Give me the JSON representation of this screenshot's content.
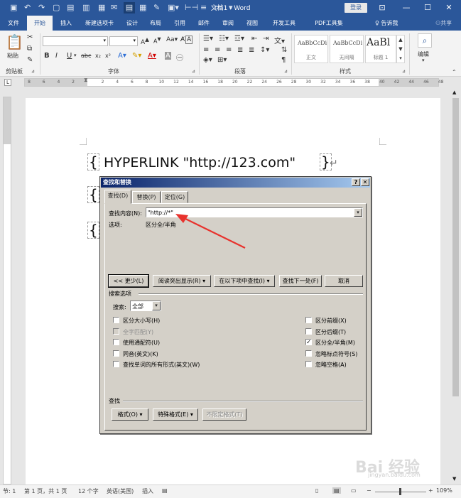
{
  "titlebar": {
    "title": "文档1 - Word",
    "login": "登录"
  },
  "menu": {
    "tabs": [
      "文件",
      "开始",
      "插入",
      "新建选项卡",
      "设计",
      "布局",
      "引用",
      "邮件",
      "审阅",
      "视图",
      "开发工具",
      "PDF工具集"
    ],
    "active_index": 1,
    "tell_me": "告诉我",
    "share": "共享"
  },
  "ribbon": {
    "clipboard_label": "剪贴板",
    "paste": "粘贴",
    "font_label": "字体",
    "paragraph_label": "段落",
    "styles_label": "样式",
    "edit": "编辑",
    "styles": [
      {
        "sample": "AaBbCcDi",
        "name": "正文"
      },
      {
        "sample": "AaBbCcDi",
        "name": "无间隔"
      },
      {
        "sample": "AaBl",
        "name": "标题 1"
      }
    ]
  },
  "ruler": {
    "labels": [
      "8",
      "6",
      "4",
      "2",
      "",
      "2",
      "4",
      "6",
      "8",
      "10",
      "12",
      "14",
      "16",
      "18",
      "20",
      "22",
      "24",
      "26",
      "28",
      "30",
      "32",
      "34",
      "36",
      "38",
      "40",
      "42",
      "44",
      "46",
      "48"
    ]
  },
  "document": {
    "field_code": " HYPERLINK \"http://123.com\" "
  },
  "dialog": {
    "title": "查找和替换",
    "tabs": [
      "查找(D)",
      "替换(P)",
      "定位(G)"
    ],
    "find_label": "查找内容(N):",
    "find_value": "\"http://*\"",
    "options_label": "选项:",
    "options_value": "区分全/半角",
    "buttons": {
      "less": "<< 更少(L)",
      "reading_highlight": "阅读突出显示(R) ▾",
      "find_in": "在以下项中查找(I) ▾",
      "find_next": "查找下一处(F)",
      "cancel": "取消"
    },
    "search_options_label": "搜索选项",
    "search_label": "搜索:",
    "search_value": "全部",
    "left_options": [
      {
        "label": "区分大小写(H)",
        "checked": false,
        "disabled": false
      },
      {
        "label": "全字匹配(Y)",
        "checked": false,
        "disabled": true
      },
      {
        "label": "使用通配符(U)",
        "checked": false,
        "disabled": false
      },
      {
        "label": "同音(英文)(K)",
        "checked": false,
        "disabled": false
      },
      {
        "label": "查找单词的所有形式(英文)(W)",
        "checked": false,
        "disabled": false
      }
    ],
    "right_options": [
      {
        "label": "区分前缀(X)",
        "checked": false
      },
      {
        "label": "区分后缀(T)",
        "checked": false
      },
      {
        "label": "区分全/半角(M)",
        "checked": true
      },
      {
        "label": "忽略标点符号(S)",
        "checked": false
      },
      {
        "label": "忽略空格(A)",
        "checked": false
      }
    ],
    "find_section_label": "查找",
    "format_button": "格式(O) ▾",
    "special_button": "特殊格式(E) ▾",
    "no_format_button": "不限定格式(T)"
  },
  "statusbar": {
    "section": "节: 1",
    "page": "第 1 页，共 1 页",
    "words": "12 个字",
    "language": "英语(美国)",
    "insert": "插入",
    "zoom": "109%"
  },
  "watermark": {
    "brand": "Bai 经验",
    "url": "jingyan.baidu.com"
  },
  "colors": {
    "accent": "#2b579a",
    "dialog_bg": "#d4d0c8",
    "arrow": "#e8322d"
  }
}
